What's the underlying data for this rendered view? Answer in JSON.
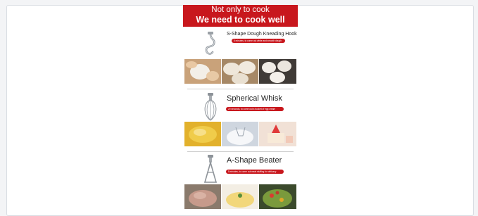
{
  "banner": {
    "line1": "Not only to cook",
    "line2": "We need to cook well"
  },
  "sections": [
    {
      "title": "S-Shape Dough Kneading Hook",
      "caption": "5 minutes, to come out white and smooth dough"
    },
    {
      "title": "Spherical Whisk",
      "caption": "20 seconds, to come out a bucket of egg cream"
    },
    {
      "title": "A-Shape Beater",
      "caption": "5 minutes, to come out meat stuffing for delicacy"
    }
  ],
  "colors": {
    "accent": "#c8171d",
    "text": "#222222"
  }
}
